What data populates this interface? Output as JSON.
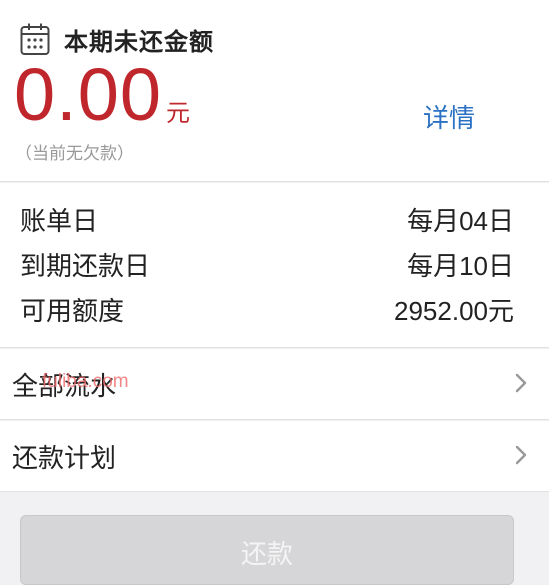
{
  "header": {
    "title": "本期未还金额",
    "amount": "0.00",
    "currency": "元",
    "details_link": "详情",
    "note": "（当前无欠款）"
  },
  "info": {
    "rows": [
      {
        "label": "账单日",
        "value": "每月04日"
      },
      {
        "label": "到期还款日",
        "value": "每月10日"
      },
      {
        "label": "可用额度",
        "value": "2952.00元"
      }
    ]
  },
  "nav": {
    "items": [
      {
        "label": "全部流水"
      },
      {
        "label": "还款计划"
      }
    ]
  },
  "watermark": "fuliba.com",
  "footer": {
    "repay_button": "还款"
  },
  "colors": {
    "amount": "#c0272d",
    "link": "#2c72c4",
    "button_disabled": "#d6d6d8"
  },
  "icons": {
    "title_icon": "calendar-icon",
    "row_chevron": "chevron-right-icon"
  }
}
